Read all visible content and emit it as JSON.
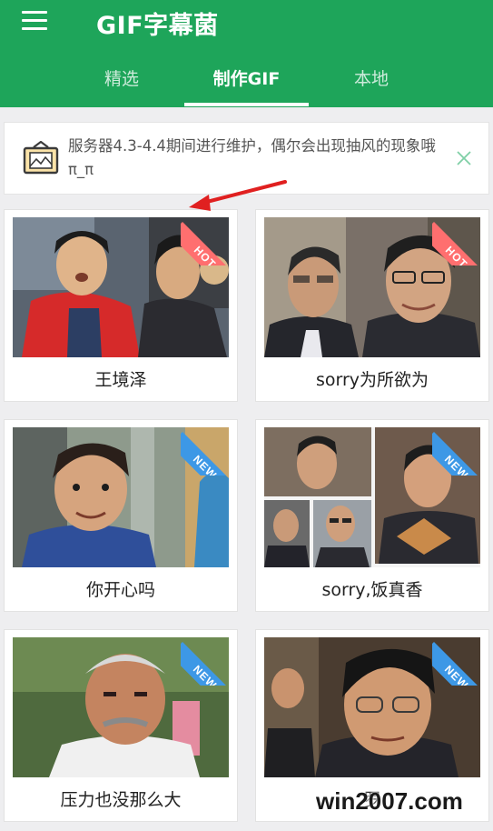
{
  "app": {
    "title": "GIF字幕菌",
    "menu_icon": "hamburger-menu-icon"
  },
  "tabs": [
    {
      "label": "精选",
      "active": false
    },
    {
      "label": "制作GIF",
      "active": true
    },
    {
      "label": "本地",
      "active": false
    }
  ],
  "notice": {
    "icon": "image-frame-icon",
    "text": "服务器4.3-4.4期间进行维护，偶尔会出现抽风的现象哦 π_π",
    "close_icon": "close-icon"
  },
  "cards": [
    {
      "label": "王境泽",
      "badge": "HOT"
    },
    {
      "label": "sorry为所欲为",
      "badge": "HOT"
    },
    {
      "label": "你开心吗",
      "badge": "NEW"
    },
    {
      "label": "sorry,饭真香",
      "badge": "NEW"
    },
    {
      "label": "压力也没那么大",
      "badge": "NEW"
    },
    {
      "label": "罗",
      "badge": "NEW"
    }
  ],
  "watermark": "win2007.com",
  "colors": {
    "appbar": "#1ea55a",
    "hot_badge": "#ff6f6f",
    "new_badge": "#3d98e6",
    "annotation_arrow": "#e02020"
  }
}
